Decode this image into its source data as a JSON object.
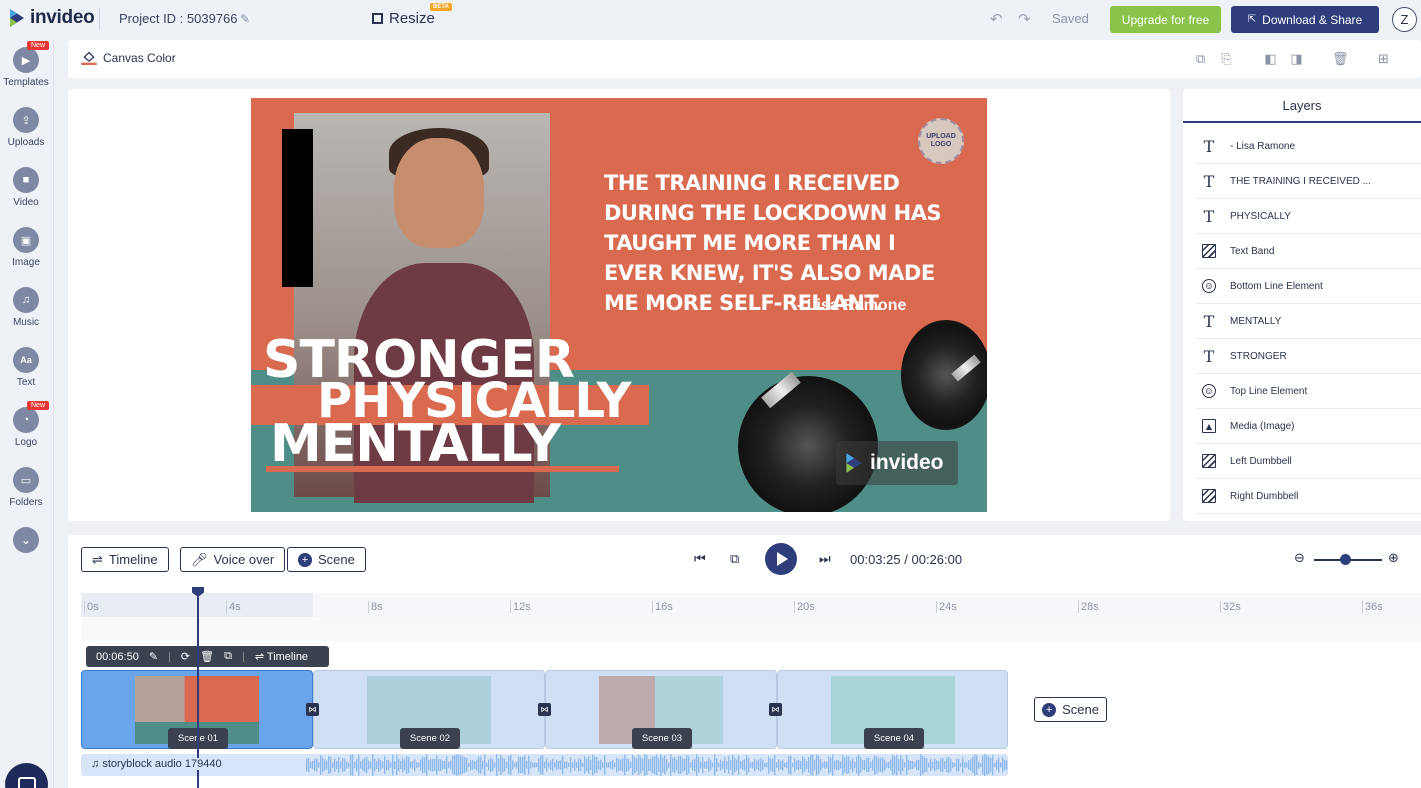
{
  "topbar": {
    "brand": "invideo",
    "project_id": "Project ID : 5039766",
    "resize_label": "Resize",
    "beta_badge": "BETA",
    "saved_label": "Saved",
    "upgrade_label": "Upgrade for free",
    "download_label": "Download & Share",
    "avatar_initial": "Z"
  },
  "sidebar": {
    "items": [
      {
        "label": "Templates",
        "badge": "New",
        "icon": "templates-icon"
      },
      {
        "label": "Uploads",
        "badge": "",
        "icon": "upload-icon"
      },
      {
        "label": "Video",
        "badge": "",
        "icon": "video-icon"
      },
      {
        "label": "Image",
        "badge": "",
        "icon": "image-icon"
      },
      {
        "label": "Music",
        "badge": "",
        "icon": "music-icon"
      },
      {
        "label": "Text",
        "badge": "",
        "icon": "text-icon"
      },
      {
        "label": "Logo",
        "badge": "New",
        "icon": "logo-icon"
      },
      {
        "label": "Folders",
        "badge": "",
        "icon": "folder-icon"
      }
    ]
  },
  "toolbar": {
    "canvas_color_label": "Canvas Color"
  },
  "slide": {
    "quote": "THE TRAINING I RECEIVED DURING THE LOCKDOWN HAS TAUGHT ME MORE THAN I EVER KNEW, IT'S ALSO MADE ME MORE SELF-RELIANT.",
    "author": "- Lisa Ramone",
    "word1": "STRONGER",
    "word2": "PHYSICALLY",
    "word3": "MENTALLY",
    "upload_logo": "UPLOAD LOGO",
    "watermark": "invideo",
    "colors": {
      "coral": "#d9694f",
      "teal": "#4e8e86"
    }
  },
  "layers": {
    "tab_label": "Layers",
    "items": [
      {
        "type": "text",
        "name": "- Lisa Ramone"
      },
      {
        "type": "text",
        "name": "THE TRAINING I RECEIVED ..."
      },
      {
        "type": "text",
        "name": "PHYSICALLY"
      },
      {
        "type": "shape",
        "name": "Text Band"
      },
      {
        "type": "element",
        "name": "Bottom Line Element"
      },
      {
        "type": "text",
        "name": "MENTALLY"
      },
      {
        "type": "text",
        "name": "STRONGER"
      },
      {
        "type": "element",
        "name": "Top Line Element"
      },
      {
        "type": "image",
        "name": "Media (Image)"
      },
      {
        "type": "shape",
        "name": "Left Dumbbell"
      },
      {
        "type": "shape",
        "name": "Right Dumbbell"
      }
    ]
  },
  "timeline": {
    "timeline_btn": "Timeline",
    "voiceover_btn": "Voice over",
    "scene_btn": "Scene",
    "current_time": "00:03:25",
    "separator": "/",
    "total_time": "00:26:00",
    "ticks": [
      "0s",
      "4s",
      "8s",
      "12s",
      "16s",
      "20s",
      "24s",
      "28s",
      "32s",
      "36s"
    ],
    "scene_tool_duration": "00:06:50",
    "scene_tool_timeline": "Timeline",
    "scenes": [
      "Scene 01",
      "Scene 02",
      "Scene 03",
      "Scene 04"
    ],
    "add_scene_label": "Scene",
    "audio_label": "storyblock audio 179440",
    "zoom_level": 0.45
  }
}
